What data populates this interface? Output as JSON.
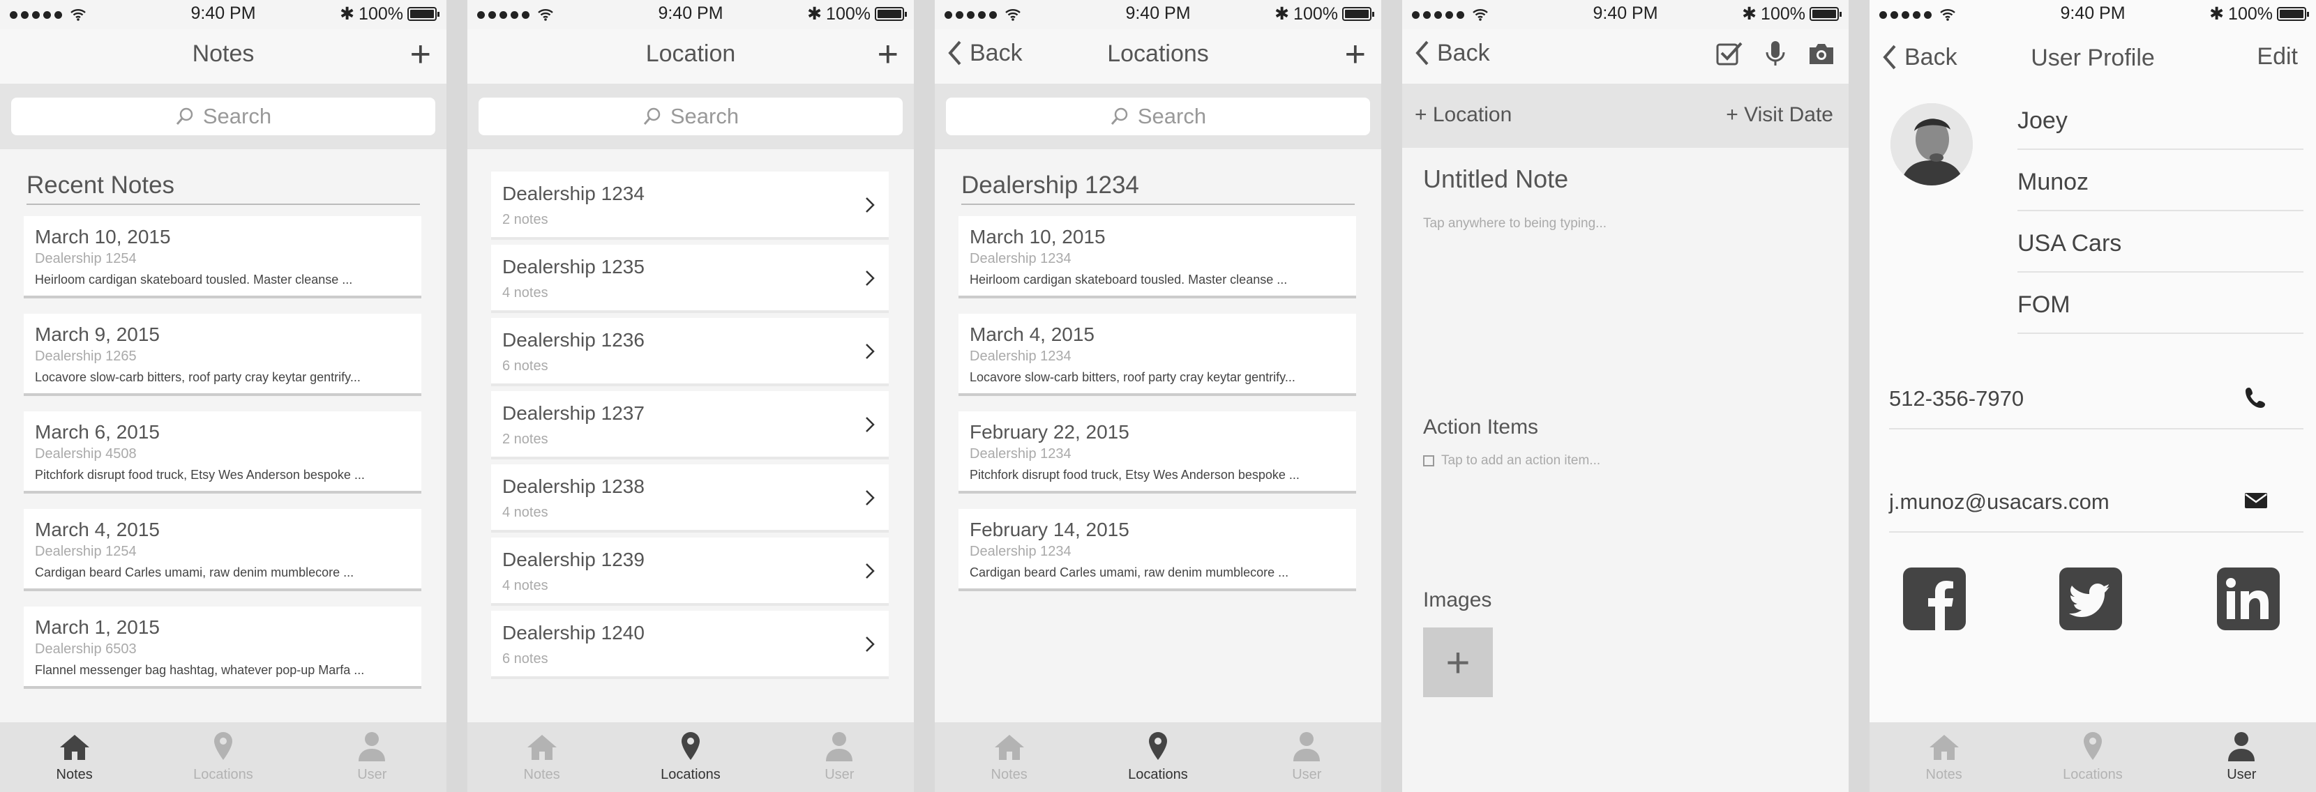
{
  "status": {
    "time": "9:40 PM",
    "battery": "100%"
  },
  "tabs": {
    "notes": "Notes",
    "locations": "Locations",
    "user": "User"
  },
  "search_placeholder": "Search",
  "screen1": {
    "title": "Notes",
    "section": "Recent Notes",
    "notes": [
      {
        "date": "March 10, 2015",
        "loc": "Dealership 1254",
        "text": "Heirloom cardigan skateboard tousled. Master cleanse ..."
      },
      {
        "date": "March 9, 2015",
        "loc": "Dealership 1265",
        "text": "Locavore slow-carb bitters, roof party cray keytar gentrify..."
      },
      {
        "date": "March 6, 2015",
        "loc": "Dealership 4508",
        "text": "Pitchfork disrupt food truck, Etsy Wes Anderson bespoke ..."
      },
      {
        "date": "March 4, 2015",
        "loc": "Dealership 1254",
        "text": "Cardigan beard Carles umami, raw denim mumblecore ..."
      },
      {
        "date": "March 1, 2015",
        "loc": "Dealership 6503",
        "text": "Flannel messenger bag hashtag, whatever pop-up Marfa ..."
      }
    ]
  },
  "screen2": {
    "title": "Location",
    "locations": [
      {
        "name": "Dealership 1234",
        "count": "2 notes"
      },
      {
        "name": "Dealership 1235",
        "count": "4 notes"
      },
      {
        "name": "Dealership 1236",
        "count": "6 notes"
      },
      {
        "name": "Dealership 1237",
        "count": "2 notes"
      },
      {
        "name": "Dealership 1238",
        "count": "4 notes"
      },
      {
        "name": "Dealership 1239",
        "count": "4 notes"
      },
      {
        "name": "Dealership 1240",
        "count": "6 notes"
      }
    ]
  },
  "screen3": {
    "back": "Back",
    "title": "Locations",
    "section": "Dealership 1234",
    "notes": [
      {
        "date": "March 10, 2015",
        "loc": "Dealership 1234",
        "text": "Heirloom cardigan skateboard tousled. Master cleanse ..."
      },
      {
        "date": "March 4, 2015",
        "loc": "Dealership 1234",
        "text": "Locavore slow-carb bitters, roof party cray keytar gentrify..."
      },
      {
        "date": "February 22, 2015",
        "loc": "Dealership 1234",
        "text": "Pitchfork disrupt food truck, Etsy Wes Anderson bespoke ..."
      },
      {
        "date": "February 14, 2015",
        "loc": "Dealership 1234",
        "text": "Cardigan beard Carles umami, raw denim mumblecore ..."
      }
    ]
  },
  "screen4": {
    "back": "Back",
    "location": "+ Location",
    "visit_date": "+ Visit Date",
    "note_title": "Untitled Note",
    "note_hint": "Tap anywhere to being typing...",
    "action_items": "Action Items",
    "action_hint": "Tap to add an action item...",
    "images": "Images",
    "add": "+"
  },
  "screen5": {
    "back": "Back",
    "title": "User Profile",
    "edit": "Edit",
    "first": "Joey",
    "last": "Munoz",
    "company": "USA Cars",
    "role": "FOM",
    "phone": "512-356-7970",
    "email": "j.munoz@usacars.com"
  }
}
